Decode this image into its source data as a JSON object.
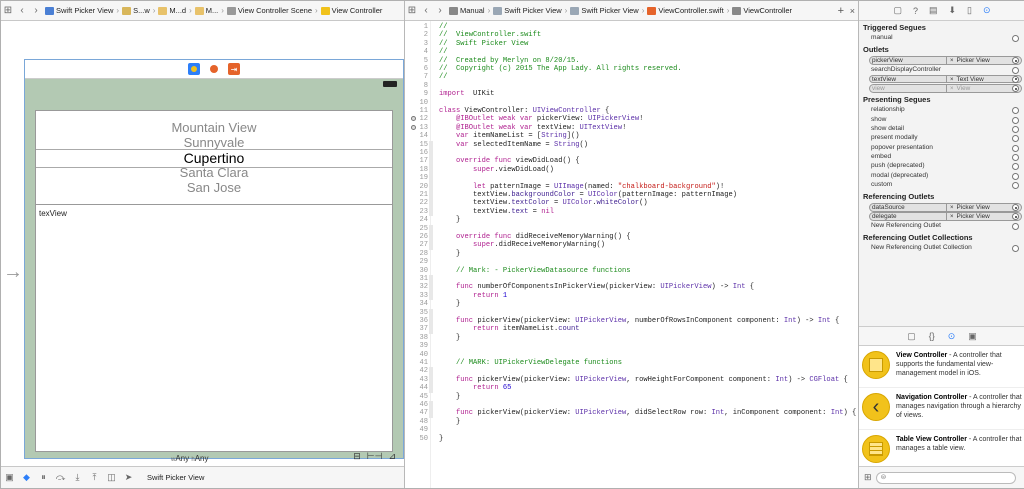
{
  "storyboard": {
    "jumpbar": [
      {
        "label": "Swift Picker View",
        "icon": "project-icon",
        "color": "#4a7fd4"
      },
      {
        "label": "S...w",
        "icon": "folder-icon",
        "color": "#d8b65a"
      },
      {
        "label": "M...d",
        "icon": "storyboard-icon",
        "color": "#e8c26a"
      },
      {
        "label": "M...",
        "icon": "storyboard-icon",
        "color": "#e8c26a"
      },
      {
        "label": "View Controller Scene",
        "icon": "scene-icon",
        "color": "#999999"
      },
      {
        "label": "View Controller",
        "icon": "view-controller-icon",
        "color": "#f1c21b"
      }
    ],
    "picker_items": [
      "Mountain View",
      "Sunnyvale",
      "Cupertino",
      "Santa Clara",
      "San Jose"
    ],
    "selected_index": 2,
    "textview_text": "texView",
    "size_class": {
      "w_label": "w",
      "w_value": "Any",
      "h_label": "h",
      "h_value": "Any"
    },
    "bottom_label": "Swift Picker View"
  },
  "editor": {
    "jumpbar": [
      {
        "label": "Manual",
        "icon": "manual-icon"
      },
      {
        "label": "Swift Picker View",
        "icon": "folder-icon"
      },
      {
        "label": "Swift Picker View",
        "icon": "folder-icon"
      },
      {
        "label": "ViewController.swift",
        "icon": "swift-file-icon"
      },
      {
        "label": "ViewController",
        "icon": "class-icon"
      }
    ],
    "lines": [
      [
        [
          "c-cm",
          "//"
        ]
      ],
      [
        [
          "c-cm",
          "//  ViewController.swift"
        ]
      ],
      [
        [
          "c-cm",
          "//  Swift Picker View"
        ]
      ],
      [
        [
          "c-cm",
          "//"
        ]
      ],
      [
        [
          "c-cm",
          "//  Created by Merlyn on 8/20/15."
        ]
      ],
      [
        [
          "c-cm",
          "//  Copyright (c) 2015 The App Lady. All rights reserved."
        ]
      ],
      [
        [
          "c-cm",
          "//"
        ]
      ],
      [],
      [
        [
          "c-kw",
          "import"
        ],
        [
          "",
          "  UIKit"
        ]
      ],
      [],
      [
        [
          "c-kw",
          "class"
        ],
        [
          "",
          " ViewController: "
        ],
        [
          "c-ty",
          "UIViewController"
        ],
        [
          "",
          " {"
        ]
      ],
      [
        [
          "",
          ""
        ],
        [
          "c-kw",
          "    @IBOutlet weak var"
        ],
        [
          "",
          " pickerView: "
        ],
        [
          "c-ty",
          "UIPickerView"
        ],
        [
          "",
          "!"
        ]
      ],
      [
        [
          "",
          ""
        ],
        [
          "c-kw",
          "    @IBOutlet weak var"
        ],
        [
          "",
          " textView: "
        ],
        [
          "c-ty",
          "UITextView"
        ],
        [
          "",
          "!"
        ]
      ],
      [
        [
          "c-kw",
          "    var"
        ],
        [
          "",
          " itemNameList = ["
        ],
        [
          "c-ty",
          "String"
        ],
        [
          "",
          "]()"
        ]
      ],
      [
        [
          "c-kw",
          "    var"
        ],
        [
          "",
          " selectedItemName = "
        ],
        [
          "c-ty",
          "String"
        ],
        [
          "",
          "()"
        ]
      ],
      [],
      [
        [
          "c-kw",
          "    override func"
        ],
        [
          "",
          " viewDidLoad() {"
        ]
      ],
      [
        [
          "c-kw",
          "        super"
        ],
        [
          "",
          ".viewDidLoad()"
        ]
      ],
      [],
      [
        [
          "c-kw",
          "        let"
        ],
        [
          "",
          " patternImage = "
        ],
        [
          "c-ty",
          "UIImage"
        ],
        [
          "",
          "(named: "
        ],
        [
          "c-st",
          "\"chalkboard-background\""
        ],
        [
          "",
          ")!"
        ]
      ],
      [
        [
          "",
          "        textView."
        ],
        [
          "c-fn",
          "backgroundColor"
        ],
        [
          "",
          " = "
        ],
        [
          "c-ty",
          "UIColor"
        ],
        [
          "",
          "(patternImage: patternImage)"
        ]
      ],
      [
        [
          "",
          "        textView."
        ],
        [
          "c-fn",
          "textColor"
        ],
        [
          "",
          " = "
        ],
        [
          "c-ty",
          "UIColor"
        ],
        [
          "",
          "."
        ],
        [
          "c-fn",
          "whiteColor"
        ],
        [
          "",
          "()"
        ]
      ],
      [
        [
          "",
          "        textView."
        ],
        [
          "c-fn",
          "text"
        ],
        [
          "",
          " = "
        ],
        [
          "c-kw",
          "nil"
        ]
      ],
      [
        [
          "",
          "    }"
        ]
      ],
      [],
      [
        [
          "c-kw",
          "    override func"
        ],
        [
          "",
          " didReceiveMemoryWarning() {"
        ]
      ],
      [
        [
          "c-kw",
          "        super"
        ],
        [
          "",
          ".didReceiveMemoryWarning()"
        ]
      ],
      [
        [
          "",
          "    }"
        ]
      ],
      [],
      [
        [
          "c-cm",
          "    // Mark: - PickerViewDatasource functions"
        ]
      ],
      [],
      [
        [
          "c-kw",
          "    func"
        ],
        [
          "",
          " numberOfComponentsInPickerView(pickerView: "
        ],
        [
          "c-ty",
          "UIPickerView"
        ],
        [
          "",
          ") -> "
        ],
        [
          "c-ty",
          "Int"
        ],
        [
          "",
          " {"
        ]
      ],
      [
        [
          "c-kw",
          "        return"
        ],
        [
          "",
          " "
        ],
        [
          "c-nu",
          "1"
        ]
      ],
      [
        [
          "",
          "    }"
        ]
      ],
      [],
      [
        [
          "c-kw",
          "    func"
        ],
        [
          "",
          " pickerView(pickerView: "
        ],
        [
          "c-ty",
          "UIPickerView"
        ],
        [
          "",
          ", numberOfRowsInComponent component: "
        ],
        [
          "c-ty",
          "Int"
        ],
        [
          "",
          ") -> "
        ],
        [
          "c-ty",
          "Int"
        ],
        [
          "",
          " {"
        ]
      ],
      [
        [
          "c-kw",
          "        return"
        ],
        [
          "",
          " itemNameList."
        ],
        [
          "c-fn",
          "count"
        ]
      ],
      [
        [
          "",
          "    }"
        ]
      ],
      [],
      [],
      [
        [
          "c-cm",
          "    // MARK: UIPickerViewDelegate functions"
        ]
      ],
      [],
      [
        [
          "c-kw",
          "    func"
        ],
        [
          "",
          " pickerView(pickerView: "
        ],
        [
          "c-ty",
          "UIPickerView"
        ],
        [
          "",
          ", rowHeightForComponent component: "
        ],
        [
          "c-ty",
          "Int"
        ],
        [
          "",
          ") -> "
        ],
        [
          "c-ty",
          "CGFloat"
        ],
        [
          "",
          " {"
        ]
      ],
      [
        [
          "c-kw",
          "        return"
        ],
        [
          "",
          " "
        ],
        [
          "c-nu",
          "65"
        ]
      ],
      [
        [
          "",
          "    }"
        ]
      ],
      [],
      [
        [
          "c-kw",
          "    func"
        ],
        [
          "",
          " pickerView(pickerView: "
        ],
        [
          "c-ty",
          "UIPickerView"
        ],
        [
          "",
          ", didSelectRow row: "
        ],
        [
          "c-ty",
          "Int"
        ],
        [
          "",
          ", inComponent component: "
        ],
        [
          "c-ty",
          "Int"
        ],
        [
          "",
          ") {"
        ]
      ],
      [
        [
          "",
          "    }"
        ]
      ],
      [],
      [
        [
          "",
          "}"
        ]
      ]
    ],
    "outlet_lines": [
      12,
      13
    ]
  },
  "inspector": {
    "triggered_segues": {
      "title": "Triggered Segues",
      "items": [
        "manual"
      ]
    },
    "outlets": {
      "title": "Outlets",
      "items": [
        {
          "name": "pickerView",
          "target": "Picker View",
          "connected": true
        },
        {
          "name": "searchDisplayController",
          "target": "",
          "connected": false
        },
        {
          "name": "textView",
          "target": "Text View",
          "connected": true
        },
        {
          "name": "view",
          "target": "View",
          "connected": true,
          "dim": true
        }
      ]
    },
    "presenting_segues": {
      "title": "Presenting Segues",
      "items": [
        "relationship",
        "show",
        "show detail",
        "present modally",
        "popover presentation",
        "embed",
        "push (deprecated)",
        "modal (deprecated)",
        "custom"
      ]
    },
    "referencing_outlets": {
      "title": "Referencing Outlets",
      "items": [
        {
          "name": "dataSource",
          "target": "Picker View",
          "connected": true
        },
        {
          "name": "delegate",
          "target": "Picker View",
          "connected": true
        }
      ],
      "new_label": "New Referencing Outlet"
    },
    "referencing_outlet_collections": {
      "title": "Referencing Outlet Collections",
      "new_label": "New Referencing Outlet Collection"
    }
  },
  "library": [
    {
      "title": "View Controller",
      "desc": " - A controller that supports the fundamental view-management model in iOS.",
      "icon": "view-controller-icon"
    },
    {
      "title": "Navigation Controller",
      "desc": " - A controller that manages navigation through a hierarchy of views.",
      "icon": "navigation-controller-icon"
    },
    {
      "title": "Table View Controller",
      "desc": " - A controller that manages a table view.",
      "icon": "table-view-controller-icon"
    }
  ],
  "colors": {
    "scene_bg": "#b3c9b3",
    "accent": "#2d7ff9"
  }
}
